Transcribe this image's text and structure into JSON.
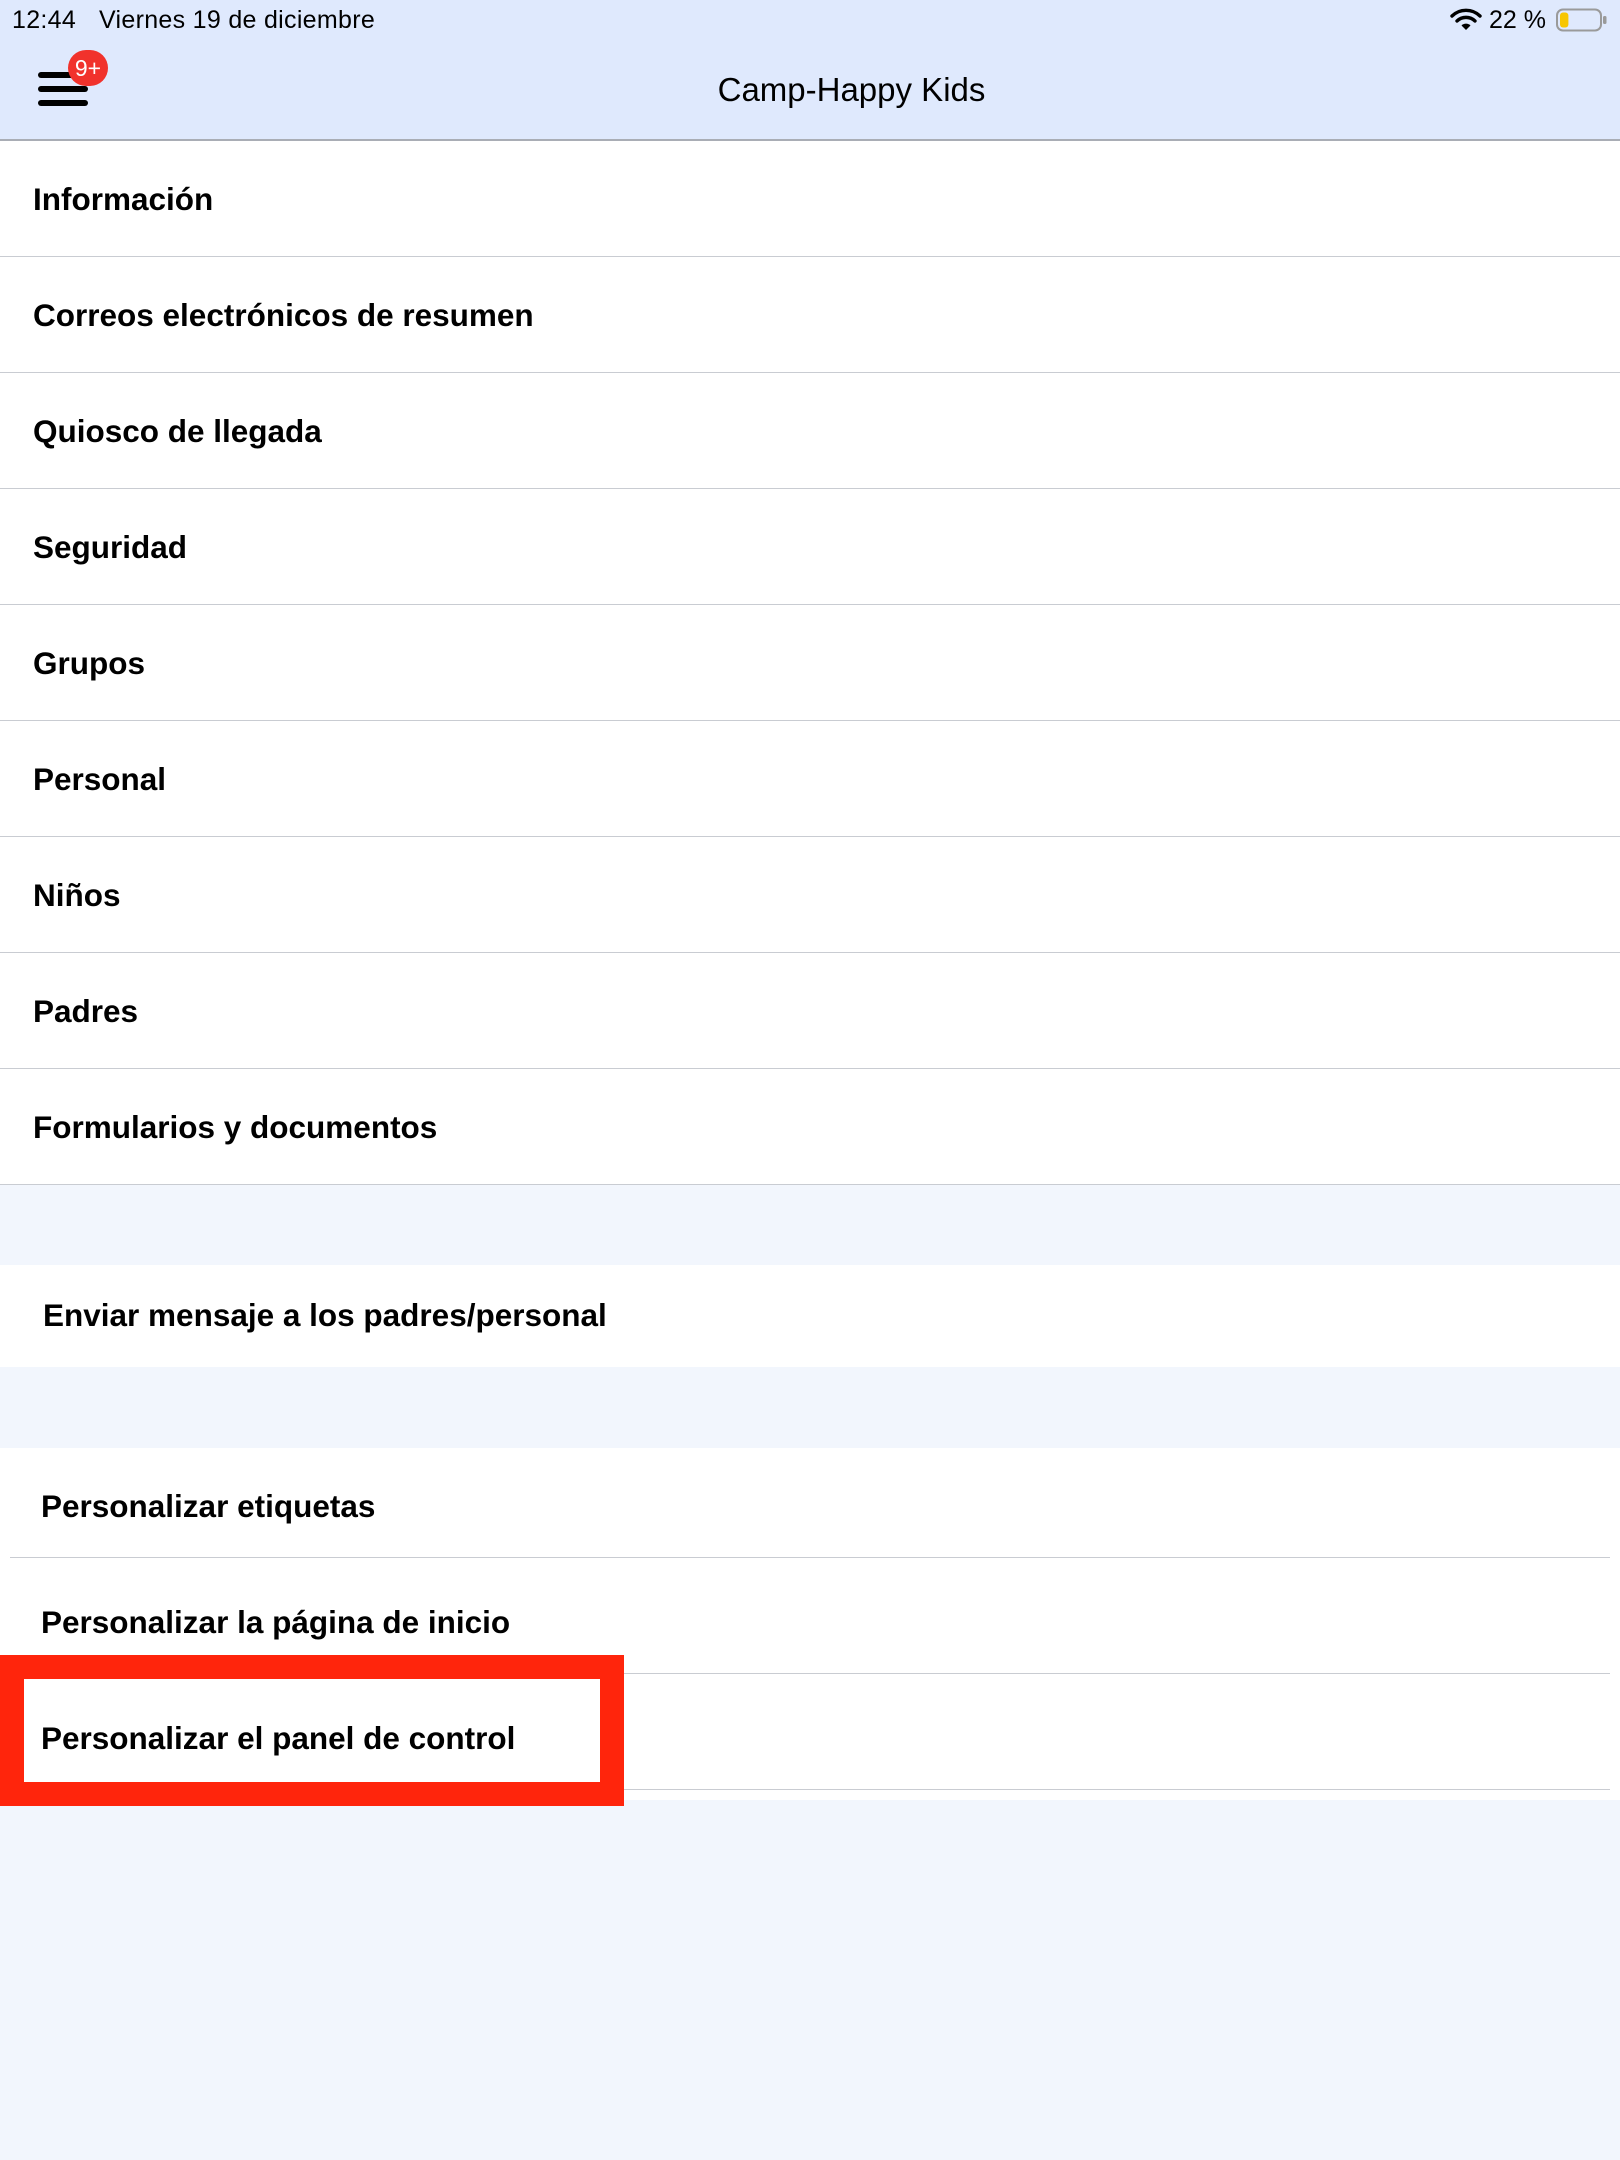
{
  "status_bar": {
    "time": "12:44",
    "date": "Viernes 19 de diciembre",
    "battery_percent": "22 %",
    "battery_level": 0.22,
    "wifi_icon": "wifi-icon",
    "battery_icon": "battery-icon"
  },
  "header": {
    "title": "Camp-Happy Kids",
    "menu_icon": "hamburger-icon",
    "badge": "9+"
  },
  "menu": {
    "items": [
      {
        "label": "Información"
      },
      {
        "label": "Correos electrónicos de resumen"
      },
      {
        "label": "Quiosco de llegada"
      },
      {
        "label": "Seguridad"
      },
      {
        "label": "Grupos"
      },
      {
        "label": "Personal"
      },
      {
        "label": "Niños"
      },
      {
        "label": "Padres"
      },
      {
        "label": "Formularios y documentos"
      }
    ]
  },
  "messaging": {
    "label": "Enviar mensaje a los padres/personal"
  },
  "customize": {
    "items": [
      {
        "label": "Personalizar etiquetas"
      },
      {
        "label": "Personalizar la página de inicio"
      },
      {
        "label": "Personalizar el panel de control"
      }
    ]
  },
  "colors": {
    "header_bg": "#dfe9fd",
    "page_bg": "#f2f6fd",
    "badge_red": "#f1322c",
    "highlight_red": "#ff250c",
    "battery_yellow": "#f7c600"
  }
}
